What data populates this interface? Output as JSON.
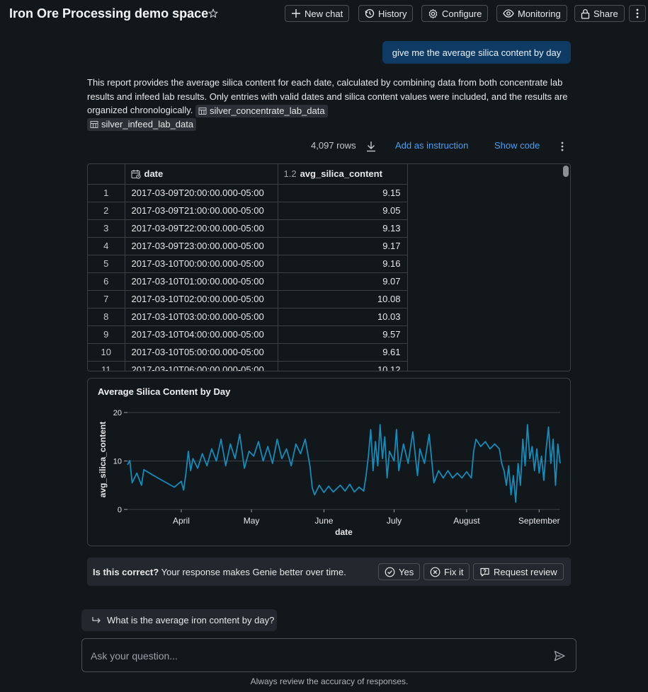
{
  "header": {
    "title": "Iron Ore Processing demo space",
    "buttons": {
      "new_chat": "New chat",
      "history": "History",
      "configure": "Configure",
      "monitoring": "Monitoring",
      "share": "Share"
    }
  },
  "conversation": {
    "user_message": "give me the average silica content by day",
    "report_text": "This report provides the average silica content for each date, calculated by combining data from both concentrate lab results and infeed lab results. Only entries with valid dates and silica content values were included, and the results are organized chronologically.",
    "sources": [
      "silver_concentrate_lab_data",
      "silver_infeed_lab_data"
    ]
  },
  "table_toolbar": {
    "row_count": "4,097 rows",
    "add_instruction": "Add as instruction",
    "show_code": "Show code"
  },
  "table": {
    "columns": [
      {
        "label": "date",
        "type_icon": "calendar-icon"
      },
      {
        "label": "avg_silica_content",
        "type_tag": "1.2"
      }
    ],
    "rows": [
      {
        "idx": "1",
        "date": "2017-03-09T20:00:00.000-05:00",
        "value": "9.15"
      },
      {
        "idx": "2",
        "date": "2017-03-09T21:00:00.000-05:00",
        "value": "9.05"
      },
      {
        "idx": "3",
        "date": "2017-03-09T22:00:00.000-05:00",
        "value": "9.13"
      },
      {
        "idx": "4",
        "date": "2017-03-09T23:00:00.000-05:00",
        "value": "9.17"
      },
      {
        "idx": "5",
        "date": "2017-03-10T00:00:00.000-05:00",
        "value": "9.16"
      },
      {
        "idx": "6",
        "date": "2017-03-10T01:00:00.000-05:00",
        "value": "9.07"
      },
      {
        "idx": "7",
        "date": "2017-03-10T02:00:00.000-05:00",
        "value": "10.08"
      },
      {
        "idx": "8",
        "date": "2017-03-10T03:00:00.000-05:00",
        "value": "10.03"
      },
      {
        "idx": "9",
        "date": "2017-03-10T04:00:00.000-05:00",
        "value": "9.57"
      },
      {
        "idx": "10",
        "date": "2017-03-10T05:00:00.000-05:00",
        "value": "9.61"
      },
      {
        "idx": "11",
        "date": "2017-03-10T06:00:00.000-05:00",
        "value": "10.12"
      }
    ]
  },
  "chart_data": {
    "type": "line",
    "title": "Average Silica Content by Day",
    "xlabel": "date",
    "ylabel": "avg_silica_content",
    "x_tick_labels": [
      "April",
      "May",
      "June",
      "July",
      "August",
      "September"
    ],
    "y_ticks": [
      0,
      10,
      20
    ],
    "ylim": [
      0,
      20
    ],
    "xlim": [
      "2017-03-09",
      "2017-09-10"
    ],
    "grid": true,
    "color": "#1a8ab8",
    "series": [
      {
        "values": [
          [
            "2017-03-09",
            9.2
          ],
          [
            "2017-03-10",
            10.1
          ],
          [
            "2017-03-11",
            5.5
          ],
          [
            "2017-03-13",
            7.5
          ],
          [
            "2017-03-15",
            5.0
          ],
          [
            "2017-03-16",
            8.2
          ],
          [
            "2017-03-22",
            6.5
          ],
          [
            "2017-03-29",
            4.6
          ],
          [
            "2017-04-01",
            5.8
          ],
          [
            "2017-04-02",
            4.0
          ],
          [
            "2017-04-03",
            7.5
          ],
          [
            "2017-04-04",
            12.0
          ],
          [
            "2017-04-05",
            8.0
          ],
          [
            "2017-04-06",
            10.5
          ],
          [
            "2017-04-08",
            8.5
          ],
          [
            "2017-04-10",
            11.5
          ],
          [
            "2017-04-12",
            9.0
          ],
          [
            "2017-04-14",
            12.5
          ],
          [
            "2017-04-16",
            10.0
          ],
          [
            "2017-04-18",
            14.5
          ],
          [
            "2017-04-20",
            9.0
          ],
          [
            "2017-04-22",
            13.5
          ],
          [
            "2017-04-24",
            10.5
          ],
          [
            "2017-04-26",
            15.5
          ],
          [
            "2017-04-28",
            8.5
          ],
          [
            "2017-04-30",
            12.0
          ],
          [
            "2017-05-02",
            11.0
          ],
          [
            "2017-05-04",
            14.0
          ],
          [
            "2017-05-06",
            10.0
          ],
          [
            "2017-05-08",
            13.0
          ],
          [
            "2017-05-10",
            9.5
          ],
          [
            "2017-05-12",
            14.5
          ],
          [
            "2017-05-14",
            10.5
          ],
          [
            "2017-05-16",
            12.5
          ],
          [
            "2017-05-18",
            9.0
          ],
          [
            "2017-05-20",
            13.5
          ],
          [
            "2017-05-22",
            11.5
          ],
          [
            "2017-05-24",
            14.5
          ],
          [
            "2017-05-26",
            9.0
          ],
          [
            "2017-05-27",
            4.5
          ],
          [
            "2017-05-28",
            3.0
          ],
          [
            "2017-05-30",
            5.0
          ],
          [
            "2017-06-01",
            3.5
          ],
          [
            "2017-06-03",
            4.8
          ],
          [
            "2017-06-05",
            3.6
          ],
          [
            "2017-06-08",
            5.0
          ],
          [
            "2017-06-10",
            3.8
          ],
          [
            "2017-06-12",
            5.2
          ],
          [
            "2017-06-14",
            3.6
          ],
          [
            "2017-06-16",
            4.6
          ],
          [
            "2017-06-18",
            3.8
          ],
          [
            "2017-06-19",
            7.0
          ],
          [
            "2017-06-20",
            11.0
          ],
          [
            "2017-06-21",
            16.5
          ],
          [
            "2017-06-22",
            8.0
          ],
          [
            "2017-06-23",
            14.0
          ],
          [
            "2017-06-24",
            9.0
          ],
          [
            "2017-06-25",
            17.5
          ],
          [
            "2017-06-26",
            10.5
          ],
          [
            "2017-06-27",
            15.0
          ],
          [
            "2017-06-28",
            6.5
          ],
          [
            "2017-06-29",
            12.0
          ],
          [
            "2017-07-01",
            10.0
          ],
          [
            "2017-07-02",
            16.5
          ],
          [
            "2017-07-03",
            8.0
          ],
          [
            "2017-07-05",
            13.5
          ],
          [
            "2017-07-07",
            9.5
          ],
          [
            "2017-07-09",
            16.0
          ],
          [
            "2017-07-11",
            7.0
          ],
          [
            "2017-07-12",
            12.5
          ],
          [
            "2017-07-14",
            9.5
          ],
          [
            "2017-07-16",
            15.5
          ],
          [
            "2017-07-18",
            5.5
          ],
          [
            "2017-07-20",
            8.0
          ],
          [
            "2017-07-22",
            6.5
          ],
          [
            "2017-07-24",
            8.0
          ],
          [
            "2017-07-26",
            6.5
          ],
          [
            "2017-07-28",
            7.5
          ],
          [
            "2017-07-30",
            6.5
          ],
          [
            "2017-08-01",
            7.8
          ],
          [
            "2017-08-03",
            6.5
          ],
          [
            "2017-08-04",
            12.0
          ],
          [
            "2017-08-05",
            14.5
          ],
          [
            "2017-08-07",
            13.0
          ],
          [
            "2017-08-09",
            14.0
          ],
          [
            "2017-08-11",
            12.5
          ],
          [
            "2017-08-13",
            13.5
          ],
          [
            "2017-08-15",
            12.5
          ],
          [
            "2017-08-16",
            9.5
          ],
          [
            "2017-08-17",
            8.0
          ],
          [
            "2017-08-18",
            5.0
          ],
          [
            "2017-08-19",
            9.0
          ],
          [
            "2017-08-20",
            3.0
          ],
          [
            "2017-08-21",
            7.0
          ],
          [
            "2017-08-22",
            1.5
          ],
          [
            "2017-08-23",
            9.5
          ],
          [
            "2017-08-24",
            5.0
          ],
          [
            "2017-08-25",
            14.5
          ],
          [
            "2017-08-26",
            9.0
          ],
          [
            "2017-08-27",
            17.5
          ],
          [
            "2017-08-28",
            10.5
          ],
          [
            "2017-08-29",
            13.0
          ],
          [
            "2017-08-30",
            8.0
          ],
          [
            "2017-08-31",
            12.5
          ],
          [
            "2017-09-01",
            7.5
          ],
          [
            "2017-09-02",
            11.0
          ],
          [
            "2017-09-03",
            6.0
          ],
          [
            "2017-09-04",
            12.5
          ],
          [
            "2017-09-05",
            17.0
          ],
          [
            "2017-09-06",
            9.5
          ],
          [
            "2017-09-07",
            14.5
          ],
          [
            "2017-09-08",
            5.0
          ],
          [
            "2017-09-09",
            13.5
          ],
          [
            "2017-09-10",
            9.5
          ]
        ]
      }
    ]
  },
  "feedback": {
    "question": "Is this correct?",
    "message": "Your response makes Genie better over time.",
    "yes": "Yes",
    "fix": "Fix it",
    "review": "Request review"
  },
  "suggestion": "What is the average iron content by day?",
  "input": {
    "placeholder": "Ask your question..."
  },
  "disclaimer": "Always review the accuracy of responses."
}
